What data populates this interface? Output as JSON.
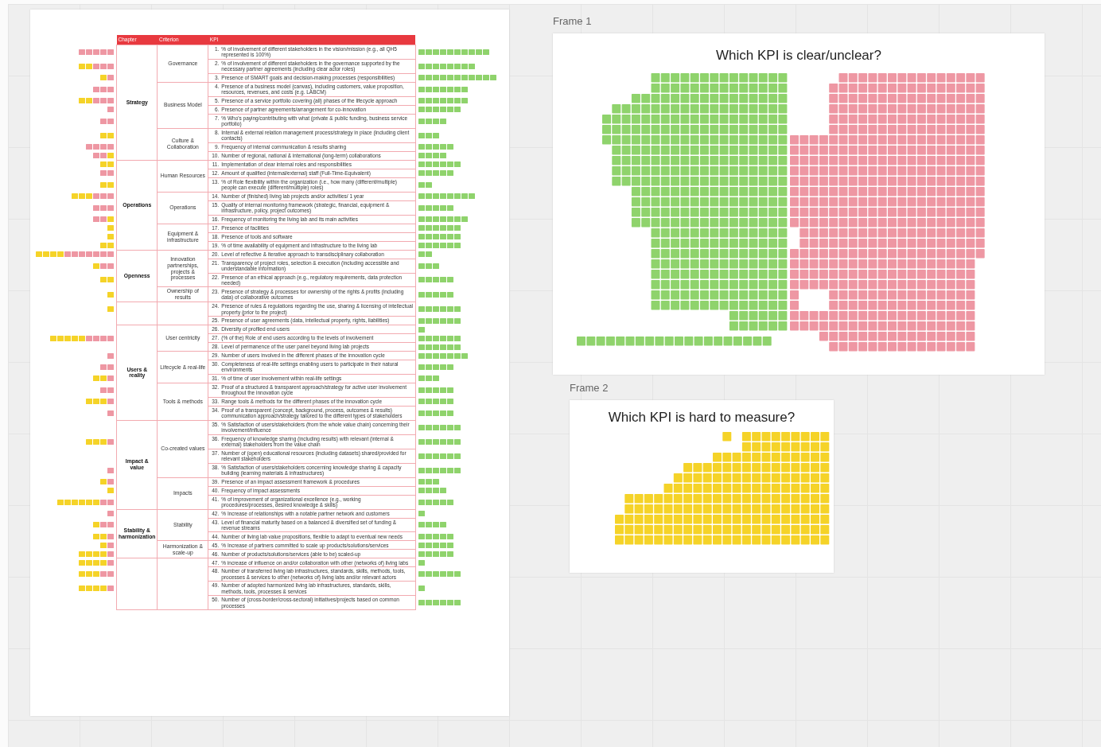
{
  "document": {
    "table": {
      "columns": [
        "Chapter",
        "Criterion",
        "KPI"
      ],
      "chapters": [
        {
          "name": "Strategy",
          "criteria": [
            {
              "name": "Governance",
              "kpis": [
                {
                  "num": "1.",
                  "text": "% of involvement of different stakeholders in the vision/mission (e.g., all QH5 represented is 100%)"
                },
                {
                  "num": "2.",
                  "text": "% of involvement of different stakeholders in the governance supported by the necessary partner agreements (including clear actor roles)"
                },
                {
                  "num": "3.",
                  "text": "Presence of SMART goals and decision-making processes (responsibilities)"
                }
              ]
            },
            {
              "name": "Business Model",
              "kpis": [
                {
                  "num": "4.",
                  "text": "Presence of a business model (canvas), including customers, value proposition, resources, revenues, and costs (e.g. LABCM)"
                },
                {
                  "num": "5.",
                  "text": "Presence of a service portfolio covering (all) phases of the lifecycle approach"
                },
                {
                  "num": "6.",
                  "text": "Presence of partner agreements/arrangement for co-innovation"
                },
                {
                  "num": "7.",
                  "text": "% Who's paying/contributing with what (private & public funding, business service portfolio)"
                }
              ]
            },
            {
              "name": "Culture & Collaboration",
              "kpis": [
                {
                  "num": "8.",
                  "text": "Internal & external relation management process/strategy in place (including client contacts)"
                },
                {
                  "num": "9.",
                  "text": "Frequency of internal communication & results sharing"
                },
                {
                  "num": "10.",
                  "text": "Number of regional, national & international (long-term) collaborations"
                }
              ]
            }
          ]
        },
        {
          "name": "Operations",
          "criteria": [
            {
              "name": "Human Resources",
              "kpis": [
                {
                  "num": "11.",
                  "text": "Implementation of clear internal roles and responsibilities"
                },
                {
                  "num": "12.",
                  "text": "Amount of qualified (internal/external) staff (Full-Time-Equivalent)"
                },
                {
                  "num": "13.",
                  "text": "% of Role flexibility within the organization (i.e., how many (different/multiple) people can execute (different/multiple) roles)"
                }
              ]
            },
            {
              "name": "Operations",
              "kpis": [
                {
                  "num": "14.",
                  "text": "Number of (finished) living lab projects and/or activities/ 1 year"
                },
                {
                  "num": "15.",
                  "text": "Quality of internal monitoring framework (strategic, financial, equipment & infrastructure, policy, project outcomes)"
                },
                {
                  "num": "16.",
                  "text": "Frequency of monitoring the living lab and its main activities"
                }
              ]
            },
            {
              "name": "Equipment & infrastructure",
              "kpis": [
                {
                  "num": "17.",
                  "text": "Presence of facilities"
                },
                {
                  "num": "18.",
                  "text": "Presence of tools and software"
                },
                {
                  "num": "19.",
                  "text": "% of time availability of equipment and infrastructure to the living lab"
                }
              ]
            }
          ]
        },
        {
          "name": "Openness",
          "criteria": [
            {
              "name": "Innovation partnerships, projects & processes",
              "kpis": [
                {
                  "num": "20.",
                  "text": "Level of reflective & iterative approach to transdisciplinary collaboration"
                },
                {
                  "num": "21.",
                  "text": "Transparency of project roles, selection & execution (including accessible and understandable information)"
                },
                {
                  "num": "22.",
                  "text": "Presence of an ethical approach (e.g., regulatory requirements, data protection needed)"
                }
              ]
            },
            {
              "name": "Ownership of results",
              "kpis": [
                {
                  "num": "23.",
                  "text": "Presence of strategy & processes for ownership of the rights & profits (including data) of collaborative outcomes"
                }
              ]
            }
          ]
        },
        {
          "criteria": [
            {
              "kpis": [
                {
                  "num": "24.",
                  "text": "Presence of rules & regulations regarding the use, sharing & licensing of intellectual property (prior to the project)"
                },
                {
                  "num": "25.",
                  "text": "Presence of user agreements (data, intellectual property, rights, liabilities)"
                }
              ]
            }
          ]
        },
        {
          "name": "Users & reality",
          "criteria": [
            {
              "name": "User centricity",
              "kpis": [
                {
                  "num": "26.",
                  "text": "Diversity of profiled end users"
                },
                {
                  "num": "27.",
                  "text": "(% of the) Role of end users according to the levels of involvement"
                },
                {
                  "num": "28.",
                  "text": "Level of permanence of the user panel beyond living lab projects"
                }
              ]
            },
            {
              "name": "Lifecycle & real-life",
              "kpis": [
                {
                  "num": "29.",
                  "text": "Number of users involved in the different phases of the innovation cycle"
                },
                {
                  "num": "30.",
                  "text": "Completeness of real-life settings enabling users to participate in their natural environments"
                },
                {
                  "num": "31.",
                  "text": "% of time of user involvement within real-life settings"
                }
              ]
            },
            {
              "name": "Tools & methods",
              "kpis": [
                {
                  "num": "32.",
                  "text": "Proof of a structured & transparent approach/strategy for active user involvement throughout the innovation cycle"
                },
                {
                  "num": "33.",
                  "text": "Range tools & methods for the different phases of the innovation cycle"
                },
                {
                  "num": "34.",
                  "text": "Proof of a transparent (concept, background, process, outcomes & results) communication approach/strategy tailored to the different types of stakeholders"
                }
              ]
            }
          ]
        },
        {
          "name": "Impact & value",
          "criteria": [
            {
              "name": "Co-created values",
              "kpis": [
                {
                  "num": "35.",
                  "text": "% Satisfaction of users/stakeholders (from the whole value chain) concerning their involvement/influence"
                },
                {
                  "num": "36.",
                  "text": "Frequency of knowledge sharing (including results) with relevant (internal & external) stakeholders from the value chain"
                },
                {
                  "num": "37.",
                  "text": "Number of (open) educational resources (including datasets) shared/provided for relevant stakeholders"
                },
                {
                  "num": "38.",
                  "text": "% Satisfaction of users/stakeholders concerning knowledge sharing & capacity building (learning materials & infrastructures)"
                }
              ]
            },
            {
              "name": "Impacts",
              "kpis": [
                {
                  "num": "39.",
                  "text": "Presence of an impact assessment framework & procedures"
                },
                {
                  "num": "40.",
                  "text": "Frequency of impact assessments"
                },
                {
                  "num": "41.",
                  "text": "% of improvement of organizational excellence (e.g., working procedures/processes, desired knowledge & skills)"
                }
              ]
            }
          ]
        },
        {
          "name": "Stability & harmonization",
          "criteria": [
            {
              "name": "Stability",
              "kpis": [
                {
                  "num": "42.",
                  "text": "% Increase of relationships with a notable partner network and customers"
                },
                {
                  "num": "43.",
                  "text": "Level of financial maturity based on a balanced & diversified set of funding & revenue streams"
                },
                {
                  "num": "44.",
                  "text": "Number of living lab value propositions, flexible to adapt to eventual new needs"
                }
              ]
            },
            {
              "name": "Harmonization & scale-up",
              "kpis": [
                {
                  "num": "45.",
                  "text": "% Increase of partners committed to scale up products/solutions/services"
                },
                {
                  "num": "46.",
                  "text": "Number of products/solutions/services (able to be) scaled-up"
                }
              ]
            }
          ]
        },
        {
          "criteria": [
            {
              "kpis": [
                {
                  "num": "47.",
                  "text": "% increase of influence on and/or collaboration with other (networks of) living labs"
                },
                {
                  "num": "48.",
                  "text": "Number of transferred living lab infrastructures, standards, skills, methods, tools, processes & services to other (networks of) living labs and/or relevant actors"
                },
                {
                  "num": "49.",
                  "text": "Number of adopted harmonized living lab infrastructures, standards, skills, methods, tools, processes & services"
                },
                {
                  "num": "50.",
                  "text": "Number of (cross-border/cross-sectoral) initiatives/projects based on common processes"
                }
              ]
            }
          ]
        }
      ]
    }
  },
  "frames": [
    {
      "label": "Frame 1",
      "question": "Which KPI is clear/unclear?",
      "clusters": [
        {
          "color": "#8fd36c"
        },
        {
          "color": "#ee97a3"
        }
      ]
    },
    {
      "label": "Frame 2",
      "question": "Which KPI is hard to measure?",
      "clusters": [
        {
          "color": "#f5d328"
        }
      ]
    }
  ]
}
